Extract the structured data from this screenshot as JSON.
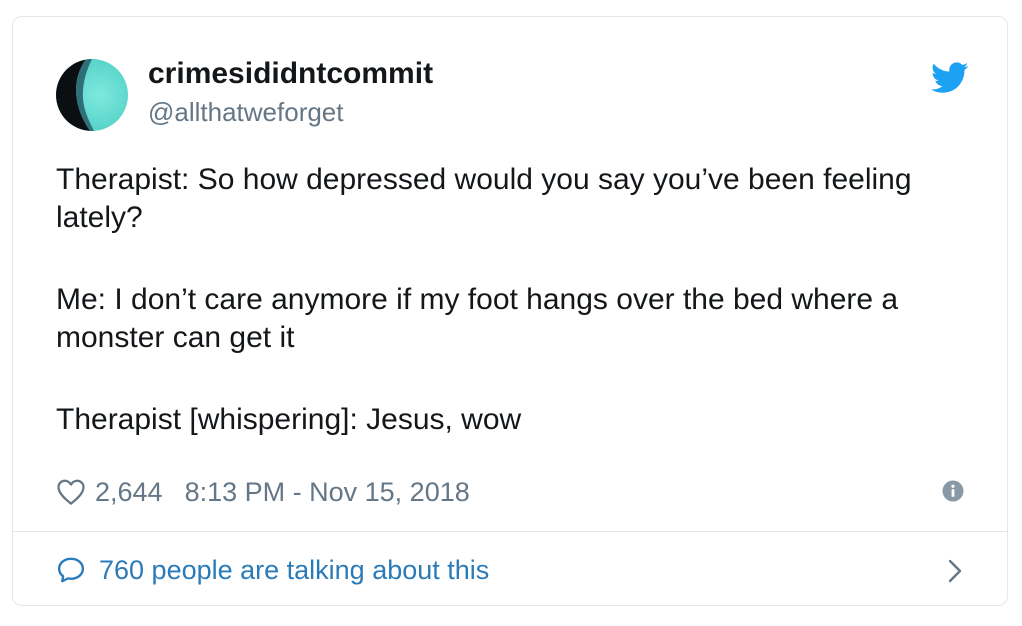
{
  "author": {
    "display_name": "crimesididntcommit",
    "handle": "@allthatweforget"
  },
  "tweet": {
    "paragraphs": [
      "Therapist: So how depressed would you say you’ve been feeling lately?",
      "Me: I don’t care anymore if my foot hangs over the bed where a monster can get it",
      "Therapist [whispering]: Jesus, wow"
    ]
  },
  "meta": {
    "like_count": "2,644",
    "timestamp": "8:13 PM - Nov 15, 2018"
  },
  "conversation": {
    "label": "760 people are talking about this"
  },
  "icons": {
    "logo": "twitter-bird-icon",
    "like": "heart-icon",
    "info": "info-icon",
    "reply": "speech-bubble-icon",
    "more": "chevron-right-icon"
  },
  "colors": {
    "twitter_blue": "#1da1f2",
    "link_blue": "#2b7bb9",
    "text_primary": "#14171a",
    "text_secondary": "#657786",
    "border": "#e1e8ed",
    "avatar_teal": "#5ad8cc"
  }
}
